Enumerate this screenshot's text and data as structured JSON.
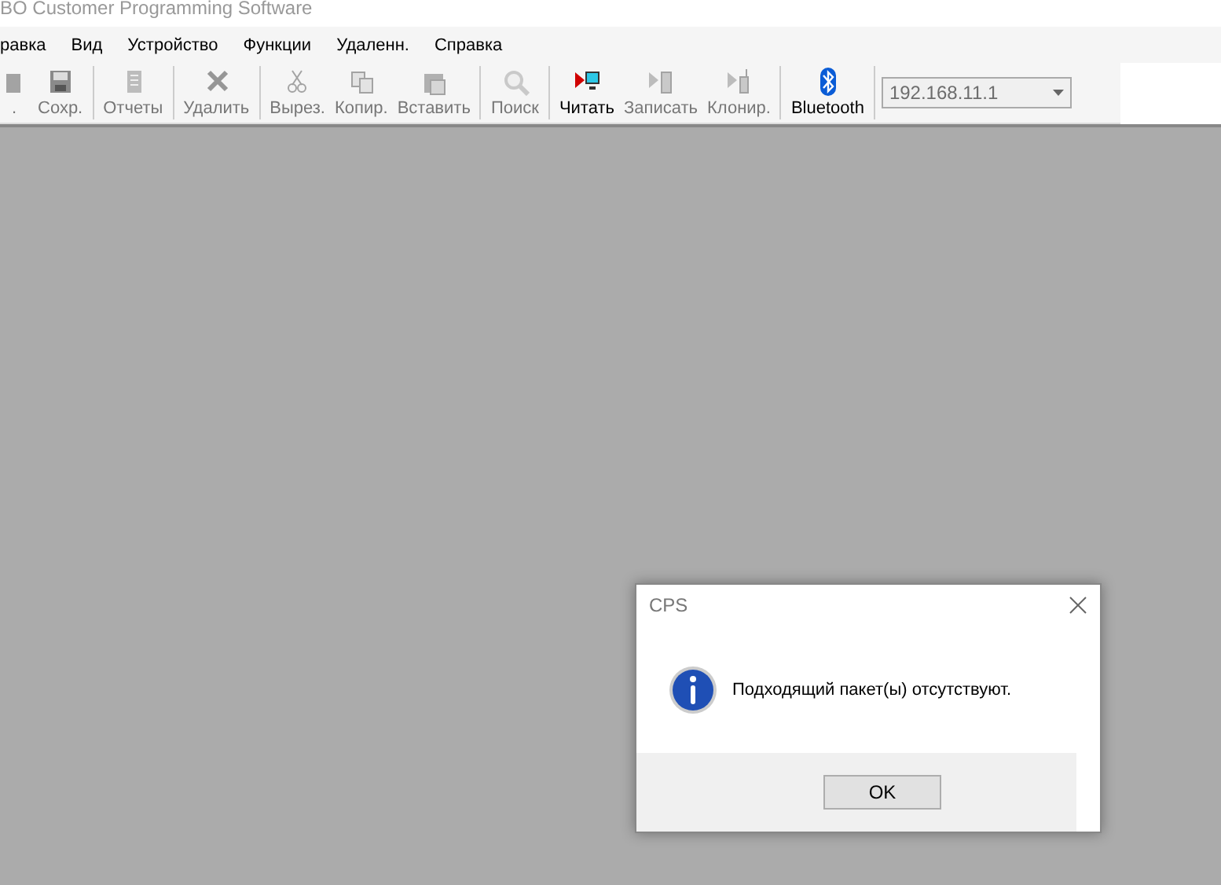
{
  "window": {
    "title": "BO Customer Programming Software"
  },
  "menu": [
    "равка",
    "Вид",
    "Устройство",
    "Функции",
    "Удаленн.",
    "Справка"
  ],
  "toolbar": {
    "groups": [
      [
        {
          "label": ".",
          "disabled": true
        },
        {
          "label": "Сохр.",
          "disabled": true
        }
      ],
      [
        {
          "label": "Отчеты",
          "disabled": true
        }
      ],
      [
        {
          "label": "Удалить",
          "disabled": true
        }
      ],
      [
        {
          "label": "Вырез.",
          "disabled": true
        },
        {
          "label": "Копир.",
          "disabled": true
        },
        {
          "label": "Вставить",
          "disabled": true
        }
      ],
      [
        {
          "label": "Поиск",
          "disabled": true
        }
      ],
      [
        {
          "label": "Читать",
          "disabled": false
        },
        {
          "label": "Записать",
          "disabled": true
        },
        {
          "label": "Клонир.",
          "disabled": true
        }
      ],
      [
        {
          "label": "Bluetooth",
          "disabled": false
        }
      ]
    ],
    "address": {
      "value": "192.168.11.1",
      "disabled": true
    }
  },
  "dialog": {
    "title": "CPS",
    "message": "Подходящий пакет(ы) отсутствуют.",
    "buttons": [
      "OK"
    ]
  }
}
